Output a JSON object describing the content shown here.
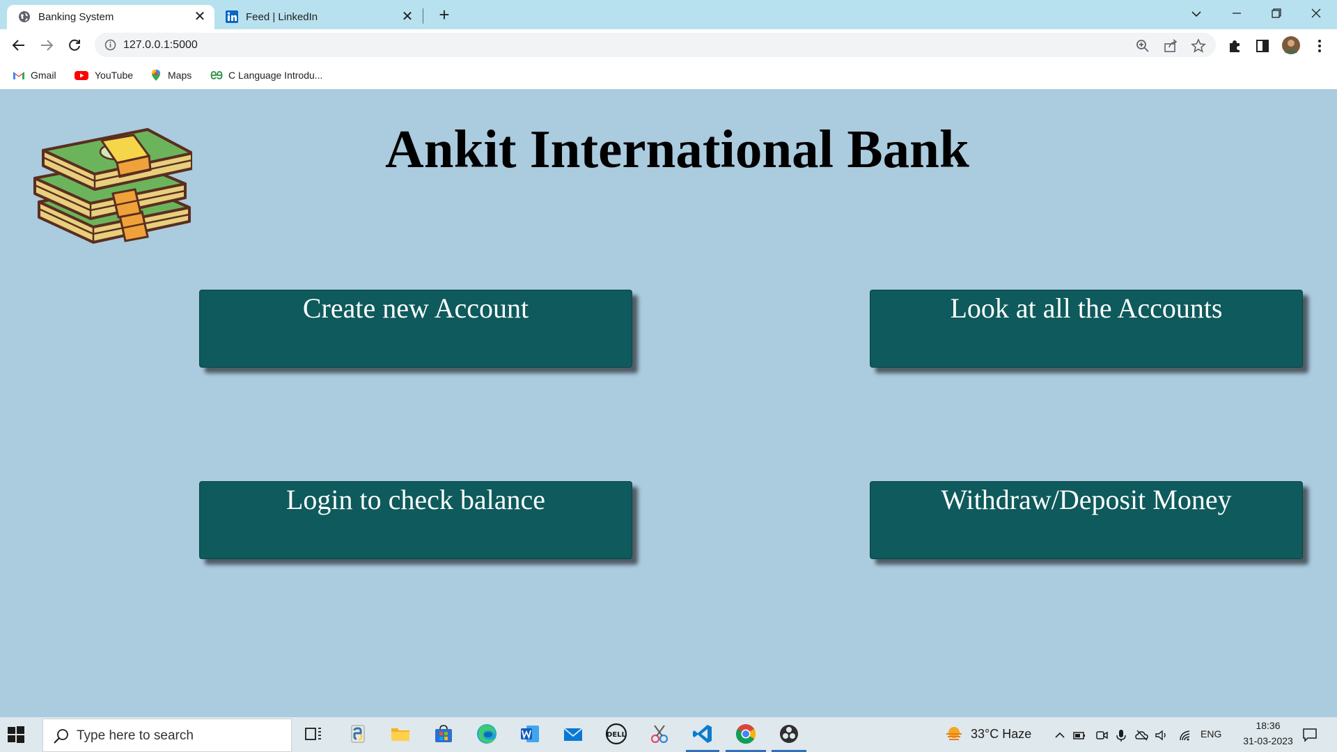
{
  "browser": {
    "tabs": [
      {
        "title": "Banking System",
        "active": true,
        "icon": "globe-icon"
      },
      {
        "title": "Feed | LinkedIn",
        "active": false,
        "icon": "linkedin-icon"
      }
    ],
    "url": "127.0.0.1:5000",
    "bookmarks": [
      {
        "label": "Gmail",
        "icon": "gmail-icon"
      },
      {
        "label": "YouTube",
        "icon": "youtube-icon"
      },
      {
        "label": "Maps",
        "icon": "maps-icon"
      },
      {
        "label": "C Language Introdu...",
        "icon": "geeksforgeeks-icon"
      }
    ]
  },
  "page": {
    "title": "Ankit International Bank",
    "buttons": {
      "create": "Create new Account",
      "view_all": "Look at all the Accounts",
      "login": "Login to check balance",
      "transact": "Withdraw/Deposit Money"
    },
    "colors": {
      "background": "#abcbde",
      "button": "#0e5a5c",
      "button_text": "#ffffff"
    }
  },
  "taskbar": {
    "search_placeholder": "Type here to search",
    "weather": "33°C  Haze",
    "language": "ENG",
    "time": "18:36",
    "date": "31-03-2023"
  }
}
